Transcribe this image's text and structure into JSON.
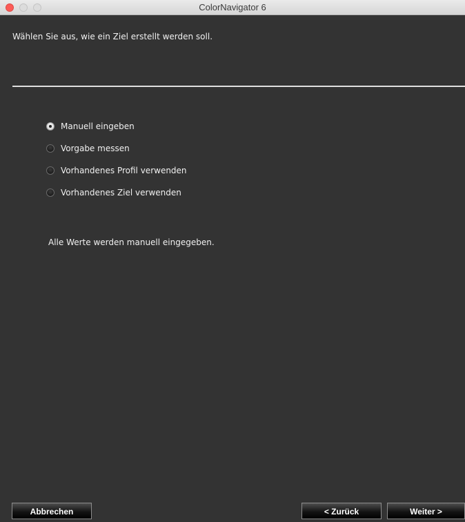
{
  "window": {
    "title": "ColorNavigator 6"
  },
  "instruction": "Wählen Sie aus, wie ein Ziel erstellt werden soll.",
  "options": [
    {
      "label": "Manuell eingeben",
      "selected": true
    },
    {
      "label": "Vorgabe messen",
      "selected": false
    },
    {
      "label": "Vorhandenes Profil verwenden",
      "selected": false
    },
    {
      "label": "Vorhandenes Ziel verwenden",
      "selected": false
    }
  ],
  "description": "Alle Werte werden manuell eingegeben.",
  "buttons": {
    "cancel": "Abbrechen",
    "back": "< Zurück",
    "next": "Weiter >"
  }
}
